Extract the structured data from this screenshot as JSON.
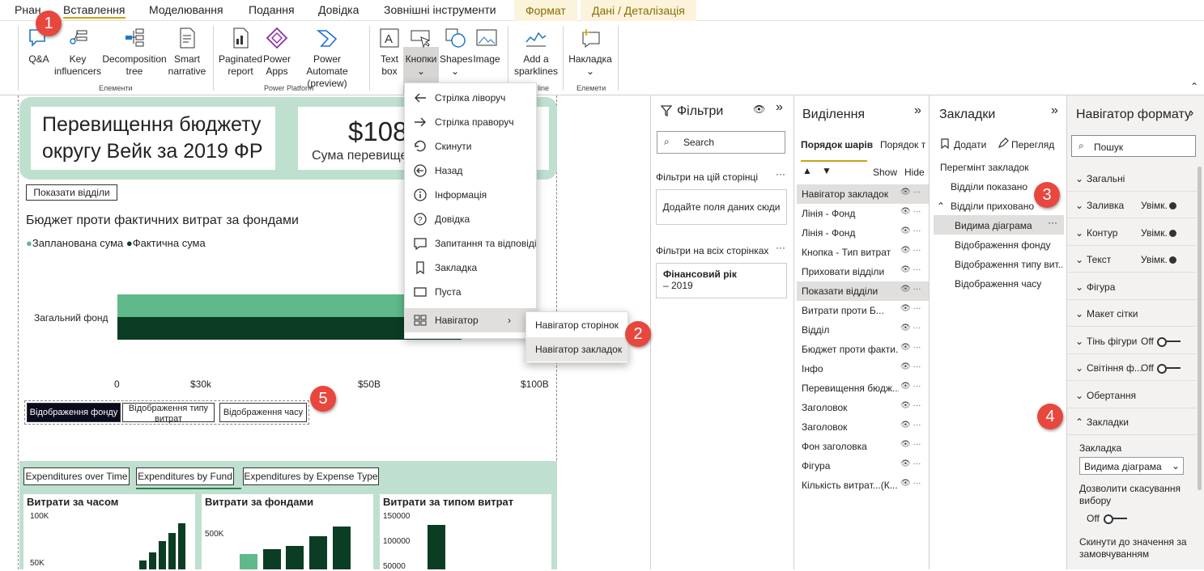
{
  "tabs": [
    "Рнан",
    "Вставлення",
    "Моделювання",
    "Подання",
    "Довідка",
    "Зовнішні інструменти",
    "Формат",
    "Дані / Деталізація"
  ],
  "ribbon": {
    "qa": "Q&A",
    "key1": "Key",
    "key2": "influencers",
    "dec1": "Decomposition",
    "dec2": "tree",
    "smart1": "Smart",
    "smart2": "narrative",
    "pag1": "Paginated",
    "pag2": "report",
    "pow1": "Power",
    "pow2": "Apps",
    "pa1": "Power Automate",
    "pa2": "(preview)",
    "text1": "Text",
    "text2": "box",
    "buttons": "Кнопки",
    "shapes": "Shapes",
    "image": "Image",
    "spark1": "Add a",
    "spark2": "sparklines",
    "overlay": "Накладка",
    "g_elements": "Елементи",
    "g_power": "Power Platform",
    "g_sparkline": "line",
    "g_elements2": "Елемети"
  },
  "callouts": [
    "1",
    "2",
    "3",
    "4",
    "5"
  ],
  "menu": {
    "items": [
      "Стрілка ліворуч",
      "Стрілка праворуч",
      "Скинути",
      "Назад",
      "Інформація",
      "Довідка",
      "Запитання та відповіді",
      "Закладка",
      "Пуста",
      "Навігатор"
    ],
    "sub": [
      "Навігатор сторінок",
      "Навігатор закладок"
    ]
  },
  "report": {
    "title": "Перевищення бюджету округу Вейк за 2019 ФР",
    "kpi_value": "$108",
    "kpi_label": "Сума перевищен",
    "show_button": "Показати відділи",
    "chart_title": "Бюджет проти фактичних витрат за фондами",
    "legend1": "Запланована сума",
    "legend2": "Фактична сума",
    "category": "Загальний фонд",
    "ticks": [
      "0",
      "$30k",
      "$50B",
      "$100B"
    ],
    "nav_buttons": [
      "Відображення фонду",
      "Відображення типу витрат",
      "Відображення часу"
    ],
    "tabs": [
      "Expenditures over Time",
      "Expenditures by Fund",
      "Expenditures by Expense Type"
    ],
    "mini1_title": "Витрати за часом",
    "mini1_ticks": [
      "100K",
      "50K"
    ],
    "mini2_title": "Витрати за фондами",
    "mini2_ticks": [
      "500K"
    ],
    "mini3_title": "Витрати за типом витрат",
    "mini3_ticks": [
      "150000",
      "100000",
      "50000"
    ]
  },
  "chart_data": {
    "type": "bar",
    "title": "Бюджет проти фактичних витрат за фондами",
    "categories": [
      "Загальний фонд"
    ],
    "series": [
      {
        "name": "Запланована сума",
        "values": [
          100
        ]
      },
      {
        "name": "Фактична сума",
        "values": [
          90
        ]
      }
    ],
    "xlim": [
      0,
      100
    ]
  },
  "filters": {
    "title": "Фільтри",
    "search": "Search",
    "page_label": "Фільтри на цій сторінці",
    "page_drop": "Додайте поля даних сюди",
    "all_label": "Фільтри на всіх сторінках",
    "card_title": "Фінансовий рік",
    "card_value": "– 2019"
  },
  "selection": {
    "title": "Виділення",
    "tab1": "Порядок шарів",
    "tab2": "Порядок т",
    "show": "Show",
    "hide": "Hide",
    "items": [
      "Навігатор закладок",
      "Лінія - Фонд",
      "Лінія - Фонд",
      "Кнопка - Тип витрат",
      "Приховати відділи",
      "Показати відділи",
      "Витрати проти Б...",
      "Відділ",
      "Бюджет проти факти...",
      "Інфо",
      "Перевищення бюдж...",
      "Заголовок",
      "Заголовок",
      "Фон заголовка",
      "Фігура",
      "Кількість витрат...(К..."
    ]
  },
  "bookmarks": {
    "title": "Закладки",
    "add": "Додати",
    "view": "Перегляд",
    "items": [
      "Перегмінт закладок",
      "Відділи показано",
      "Відділи приховано",
      "Видима діаграма",
      "Відображення фонду",
      "Відображення типу вит...",
      "Відображення часу"
    ]
  },
  "format": {
    "title": "Навігатор формату",
    "search": "Пошук",
    "sections": [
      "Загальні",
      "Заливка",
      "Контур",
      "Текст",
      "Фігура",
      "Макет сітки",
      "Тінь фігури",
      "Світіння ф...",
      "Обертання",
      "Закладки"
    ],
    "on": "Увімк.",
    "off": "Off",
    "bm_label": "Закладка",
    "bm_value": "Видима діаграма",
    "allow": "Дозволити скасування вибору",
    "allow_off": "Off",
    "reset": "Скинути до значення за замовчуванням"
  }
}
